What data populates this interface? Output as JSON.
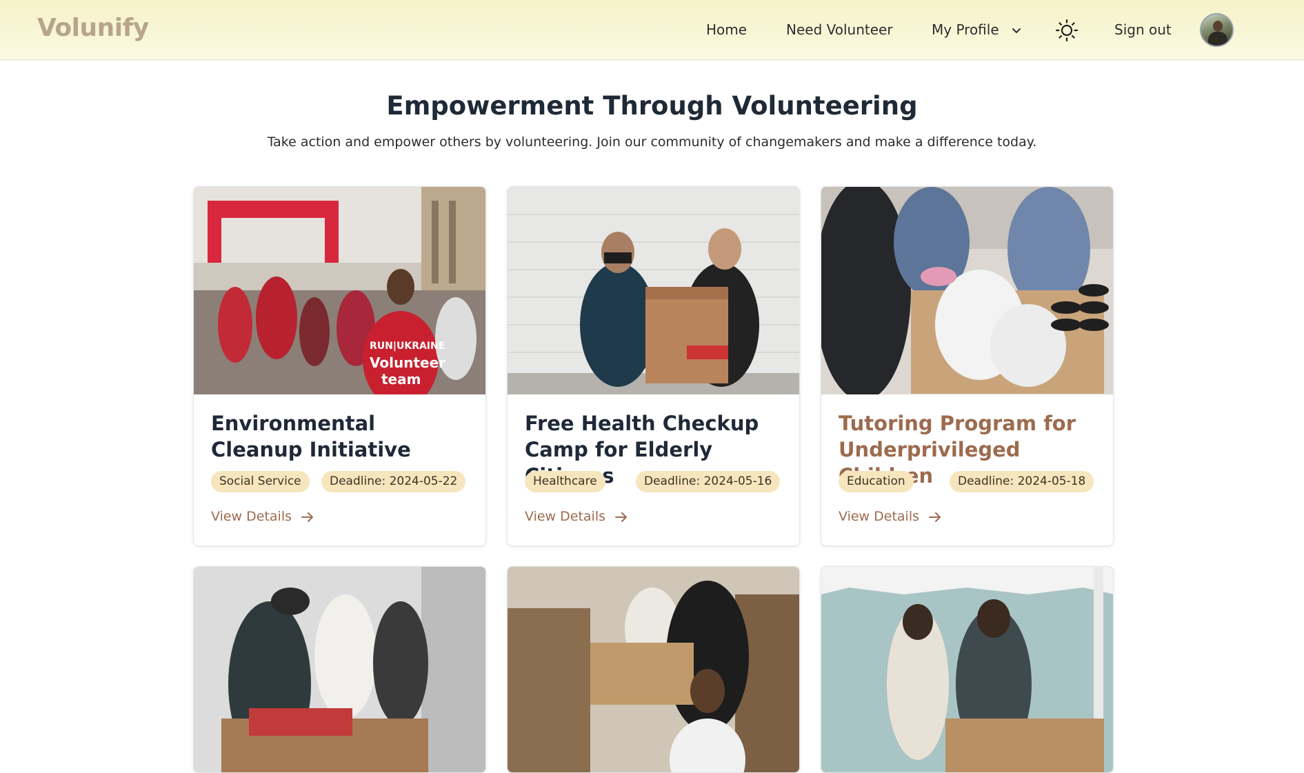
{
  "app": {
    "logo": "Volunify"
  },
  "nav": {
    "home": "Home",
    "need_volunteer": "Need Volunteer",
    "my_profile": "My Profile",
    "sign_out": "Sign out",
    "theme_icon": "sun-icon",
    "profile_icon": "chevron-down-icon"
  },
  "hero": {
    "title": "Empowerment Through Volunteering",
    "subtitle": "Take action and empower others by volunteering. Join our community of changemakers and make a difference today."
  },
  "cards": [
    {
      "title": "Environmental Cleanup Initiative",
      "category": "Social Service",
      "deadline": "Deadline: 2024-05-22",
      "link": "View Details",
      "image": "volunteer-team-marathon-photo"
    },
    {
      "title": "Free Health Checkup Camp for Elderly Citizens",
      "category": "Healthcare",
      "deadline": "Deadline: 2024-05-16",
      "link": "View Details",
      "image": "volunteers-carrying-box-photo"
    },
    {
      "title": "Tutoring Program for Underprivileged Children",
      "category": "Education",
      "deadline": "Deadline: 2024-05-18",
      "link": "View Details",
      "image": "food-packing-photo"
    },
    {
      "image": "food-bank-volunteers-photo"
    },
    {
      "image": "box-lifting-volunteers-photo"
    },
    {
      "image": "bag-packing-tent-photo"
    }
  ],
  "colors": {
    "accent": "#9c6b4e",
    "logo": "#b7a58a",
    "badge_bg": "#f7e5bd",
    "nav_bg": "#f6f2c8"
  }
}
